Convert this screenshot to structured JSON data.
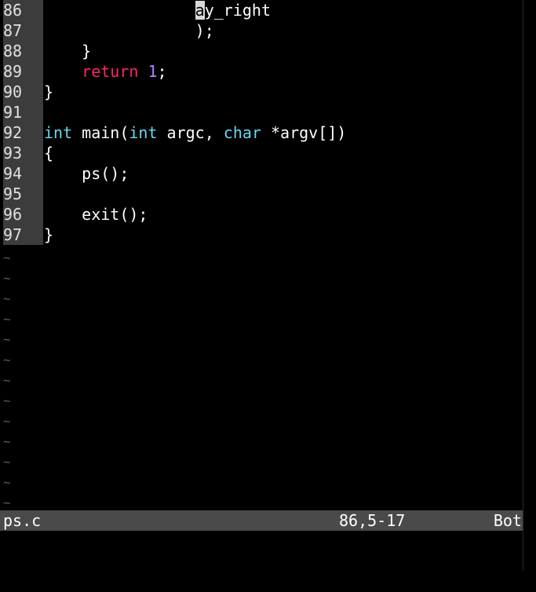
{
  "editor": {
    "lines": [
      {
        "num": "86",
        "parts": [
          {
            "t": "                ",
            "c": ""
          },
          {
            "t": "a",
            "c": "cursor"
          },
          {
            "t": "y_right",
            "c": ""
          }
        ]
      },
      {
        "num": "87",
        "parts": [
          {
            "t": "                );",
            "c": ""
          }
        ]
      },
      {
        "num": "88",
        "parts": [
          {
            "t": "    }",
            "c": ""
          }
        ]
      },
      {
        "num": "89",
        "parts": [
          {
            "t": "    ",
            "c": ""
          },
          {
            "t": "return",
            "c": "kw-ret"
          },
          {
            "t": " ",
            "c": ""
          },
          {
            "t": "1",
            "c": "num"
          },
          {
            "t": ";",
            "c": ""
          }
        ]
      },
      {
        "num": "90",
        "parts": [
          {
            "t": "}",
            "c": ""
          }
        ]
      },
      {
        "num": "91",
        "parts": [
          {
            "t": "",
            "c": ""
          }
        ]
      },
      {
        "num": "92",
        "parts": [
          {
            "t": "int",
            "c": "kw-type"
          },
          {
            "t": " main(",
            "c": ""
          },
          {
            "t": "int",
            "c": "kw-type"
          },
          {
            "t": " argc, ",
            "c": ""
          },
          {
            "t": "char",
            "c": "kw-type"
          },
          {
            "t": " *argv[])",
            "c": ""
          }
        ]
      },
      {
        "num": "93",
        "parts": [
          {
            "t": "{",
            "c": ""
          }
        ]
      },
      {
        "num": "94",
        "parts": [
          {
            "t": "    ps();",
            "c": ""
          }
        ]
      },
      {
        "num": "95",
        "parts": [
          {
            "t": "",
            "c": ""
          }
        ]
      },
      {
        "num": "96",
        "parts": [
          {
            "t": "    exit();",
            "c": ""
          }
        ]
      },
      {
        "num": "97",
        "parts": [
          {
            "t": "}",
            "c": ""
          }
        ]
      }
    ],
    "empty_marker": "~",
    "empty_lines": 13
  },
  "statusline": {
    "filename": "ps.c",
    "position": "86,5-17",
    "scroll": "Bot"
  },
  "colors": {
    "background": "#000000",
    "gutter": "#3c3c3c",
    "type_keyword": "#66d9ef",
    "return_keyword": "#f92672",
    "number": "#ae81ff",
    "statusline": "#4a4a4a"
  }
}
